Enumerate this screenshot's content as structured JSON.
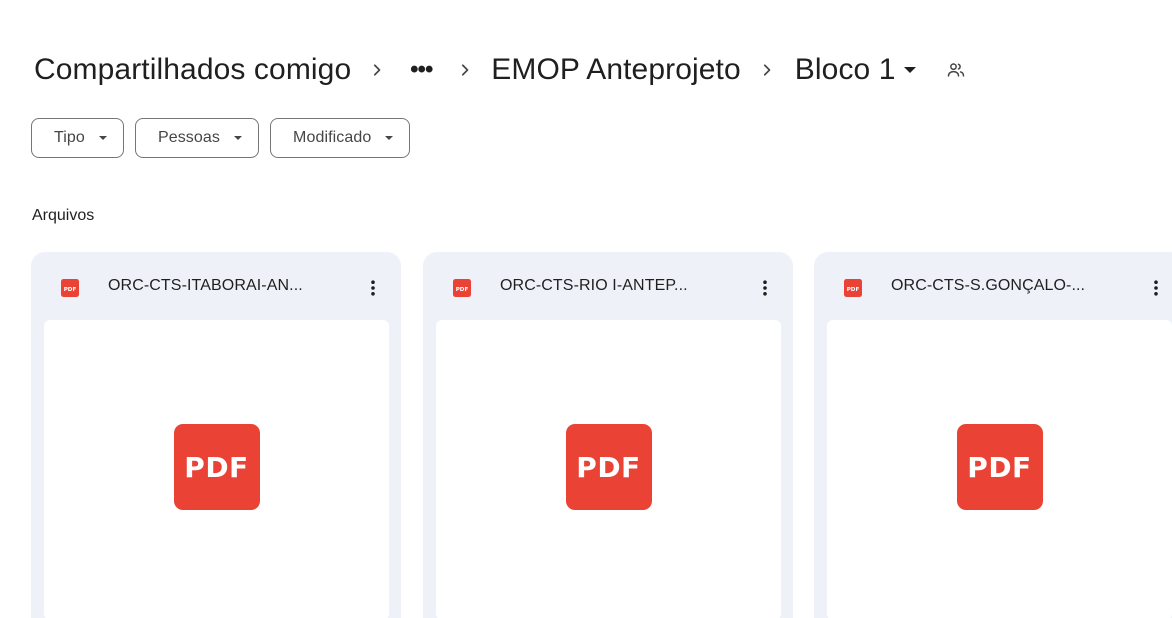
{
  "breadcrumb": {
    "root": "Compartilhados comigo",
    "more": "•••",
    "parent": "EMOP Anteprojeto",
    "current": "Bloco 1",
    "separator_icon": "chevron-right-icon",
    "shared_icon": "people-outline-icon"
  },
  "filters": [
    {
      "label": "Tipo"
    },
    {
      "label": "Pessoas"
    },
    {
      "label": "Modificado"
    }
  ],
  "section": {
    "title": "Arquivos"
  },
  "files": [
    {
      "name": "ORC-CTS-ITABORAI-AN...",
      "file_type_icon": "pdf-icon",
      "preview_label": "PDF"
    },
    {
      "name": "ORC-CTS-RIO I-ANTEP...",
      "file_type_icon": "pdf-icon",
      "preview_label": "PDF"
    },
    {
      "name": "ORC-CTS-S.GONÇALO-...",
      "file_type_icon": "pdf-icon",
      "preview_label": "PDF"
    }
  ],
  "colors": {
    "pdf_red": "#ea4335",
    "card_bg": "#eef2f8",
    "text_primary": "#1f1f1f",
    "text_secondary": "#444746",
    "chip_border": "#747775"
  }
}
